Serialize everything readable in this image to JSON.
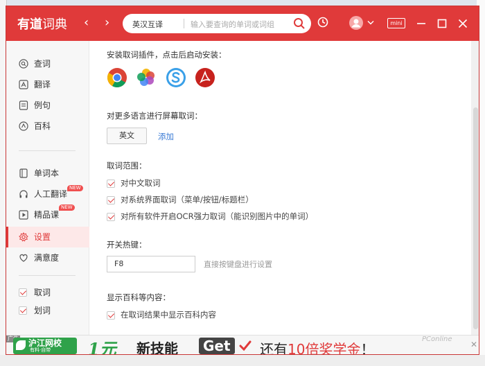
{
  "app": {
    "logo_brand": "有道",
    "logo_suffix": "词典",
    "mini_label": "mini"
  },
  "search": {
    "language": "英汉互译",
    "placeholder": "输入要查询的单词或词组"
  },
  "sidebar": {
    "items": [
      {
        "label": "查词"
      },
      {
        "label": "翻译"
      },
      {
        "label": "例句"
      },
      {
        "label": "百科"
      },
      {
        "label": "单词本"
      },
      {
        "label": "人工翻译",
        "badge": "NEW"
      },
      {
        "label": "精品课",
        "badge": "NEW"
      },
      {
        "label": "设置"
      },
      {
        "label": "满意度"
      }
    ],
    "checks": [
      {
        "label": "取词",
        "checked": true
      },
      {
        "label": "划词",
        "checked": true
      }
    ]
  },
  "settings": {
    "plugins_label": "安装取词插件，点击后启动安装：",
    "browsers": [
      "chrome-icon",
      "photos-icon",
      "sogou-browser-icon",
      "acrobat-icon"
    ],
    "multilang_label": "对更多语言进行屏幕取词：",
    "language_button": "英文",
    "add_link": "添加",
    "scope_label": "取词范围：",
    "scope_options": [
      {
        "label": "对中文取词",
        "checked": true
      },
      {
        "label": "对系统界面取词（菜单/按钮/标题栏）",
        "checked": true
      },
      {
        "label": "对所有软件开启OCR强力取词（能识别图片中的单词）",
        "checked": true
      }
    ],
    "hotkey_label": "开关热键：",
    "hotkey_value": "F8",
    "hotkey_hint": "直接按键盘进行设置",
    "baike_label": "显示百科等内容：",
    "baike_option": {
      "label": "在取词结果中显示百科内容",
      "checked": true
    }
  },
  "ad": {
    "tag": "广告",
    "brand": "沪江网校",
    "brand_sub": "有料·自带",
    "num": "1元",
    "t1": "新技能",
    "get": "Get",
    "t3a": "还有",
    "t3b": "10倍奖学金",
    "t3c": "！",
    "watermark": "PConline",
    "close": "✕"
  },
  "colors": {
    "accent": "#e03a3a",
    "link": "#3a7bd5",
    "ad_green": "#2fa24a"
  }
}
